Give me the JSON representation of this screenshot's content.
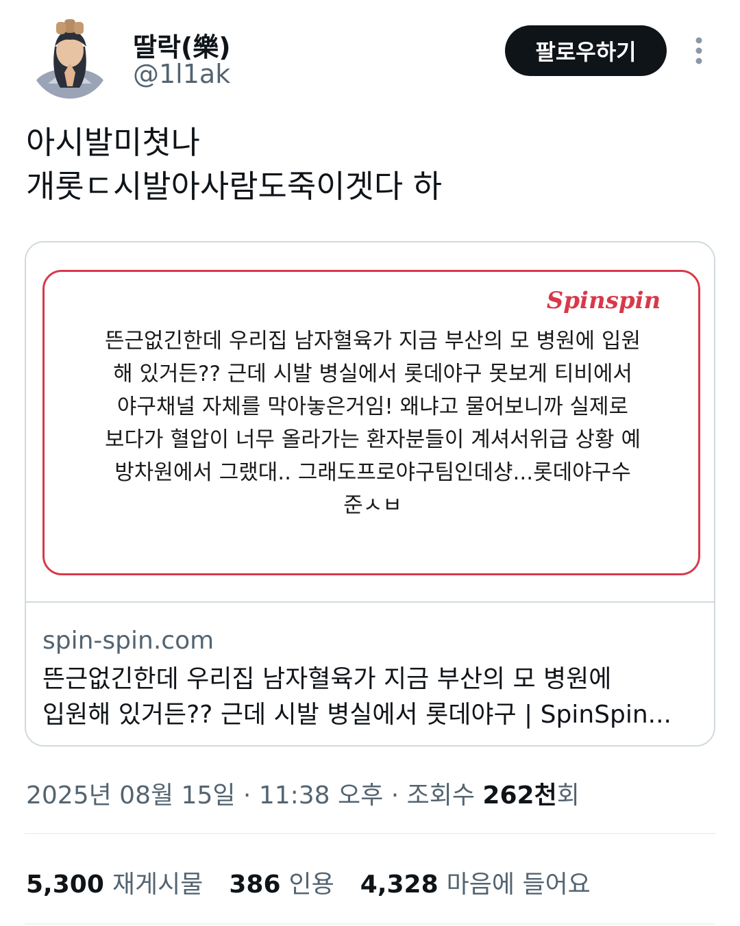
{
  "user": {
    "name": "딸락(樂)",
    "handle": "@1l1ak",
    "follow_label": "팔로우하기"
  },
  "tweet": {
    "lines": [
      "아시발미쳣나",
      "개롯ㄷ시발아사람도죽이겟다 하"
    ]
  },
  "card": {
    "brand": "Spinspin",
    "image_lines": [
      "뜬근없긴한데 우리집 남자혈육가 지금 부산의 모 병원에 입원",
      "해 있거든?? 근데 시발 병실에서 롯데야구 못보게 티비에서",
      "야구채널 자체를 막아놓은거임!  왜냐고 물어보니까 실제로",
      "보다가 혈압이 너무 올라가는 환자분들이 계셔서위급 상황 예",
      "방차원에서 그랬대.. 그래도프로야구팀인데샹...롯데야구수",
      "준ㅅㅂ"
    ],
    "domain": "spin-spin.com",
    "title_lines": [
      "뜬근없긴한데 우리집 남자혈육가 지금 부산의 모 병원에",
      "입원해 있거든?? 근데 시발 병실에서 롯데야구 | SpinSpin..."
    ]
  },
  "meta": {
    "date": "2025년 08월 15일",
    "sep1": " · ",
    "time": "11:38 오후",
    "sep2": " · ",
    "views_label": "조회수 ",
    "views_count": "262천",
    "views_suffix": "회"
  },
  "stats": {
    "retweets": {
      "count": "5,300",
      "label": "재게시물"
    },
    "quotes": {
      "count": "386",
      "label": "인용"
    },
    "likes": {
      "count": "4,328",
      "label": "마음에 들어요"
    }
  },
  "colors": {
    "text": "#0f1419",
    "secondary": "#536471",
    "border": "#cfd9de",
    "brand_red": "#d8394a",
    "button_bg": "#0f1419"
  },
  "icons": {
    "more": "more-vertical-icon",
    "avatar": "avatar"
  }
}
